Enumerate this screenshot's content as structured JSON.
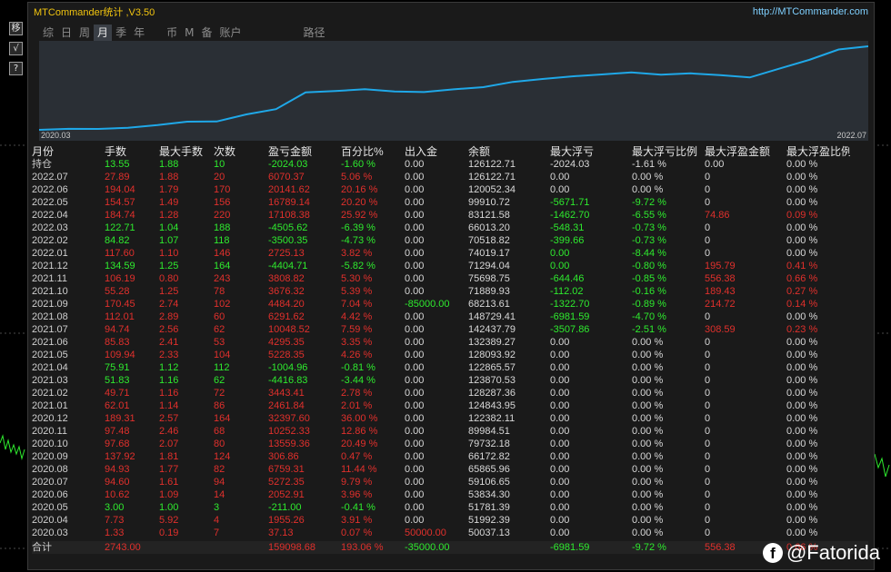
{
  "window": {
    "title": "MTCommander统计 ,V3.50",
    "url": "http://MTCommander.com"
  },
  "side_buttons": [
    "移",
    "√",
    "?"
  ],
  "tabs": [
    {
      "label": "综",
      "active": false
    },
    {
      "label": "日",
      "active": false
    },
    {
      "label": "周",
      "active": false
    },
    {
      "label": "月",
      "active": true
    },
    {
      "label": "季",
      "active": false
    },
    {
      "label": "年",
      "active": false
    },
    {
      "label": "币",
      "active": false
    },
    {
      "label": "M",
      "active": false
    },
    {
      "label": "备",
      "active": false
    },
    {
      "label": "账户",
      "active": false
    },
    {
      "label": "路径",
      "active": false
    }
  ],
  "chart_data": {
    "type": "line",
    "x_start": "2020.03",
    "x_end": "2022.07",
    "x": [
      "2020.03",
      "2020.04",
      "2020.05",
      "2020.06",
      "2020.07",
      "2020.08",
      "2020.09",
      "2020.10",
      "2020.11",
      "2020.12",
      "2021.01",
      "2021.02",
      "2021.03",
      "2021.04",
      "2021.05",
      "2021.06",
      "2021.07",
      "2021.08",
      "2021.09",
      "2021.10",
      "2021.11",
      "2021.12",
      "2022.01",
      "2022.02",
      "2022.03",
      "2022.04",
      "2022.05",
      "2022.06",
      "2022.07"
    ],
    "values": [
      37.13,
      1992.39,
      1781.39,
      3834.3,
      9106.65,
      15865.96,
      16172.82,
      29732.18,
      39984.51,
      72382.11,
      74843.95,
      78287.36,
      73870.53,
      72865.57,
      78093.92,
      82389.27,
      92437.79,
      98129.4,
      103213.61,
      106889.93,
      110698.75,
      106294.04,
      109019.17,
      105518.82,
      101013.2,
      118121.58,
      134910.72,
      155052.34,
      161122.71
    ],
    "line_color": "#1fa8e8"
  },
  "table": {
    "headers": [
      "月份",
      "手数",
      "最大手数",
      "次数",
      "盈亏金额",
      "百分比%",
      "出入金",
      "余额",
      "最大浮亏",
      "最大浮亏比例",
      "最大浮盈金额",
      "最大浮盈比例"
    ],
    "rows": [
      {
        "month": "持仓",
        "lots": "13.55",
        "max_lots": "1.88",
        "count": "10",
        "pnl": "-2024.03",
        "pct": "-1.60 %",
        "flow": "0.00",
        "balance": "126122.71",
        "max_loss": "-2024.03",
        "max_loss_pct": "-1.61 %",
        "max_gain": "0.00",
        "max_gain_pct": "0.00 %",
        "color": "g"
      },
      {
        "month": "2022.07",
        "lots": "27.89",
        "max_lots": "1.88",
        "count": "20",
        "pnl": "6070.37",
        "pct": "5.06 %",
        "flow": "0.00",
        "balance": "126122.71",
        "max_loss": "0.00",
        "max_loss_pct": "0.00 %",
        "max_gain": "0",
        "max_gain_pct": "0.00 %",
        "color": "r"
      },
      {
        "month": "2022.06",
        "lots": "194.04",
        "max_lots": "1.79",
        "count": "170",
        "pnl": "20141.62",
        "pct": "20.16 %",
        "flow": "0.00",
        "balance": "120052.34",
        "max_loss": "0.00",
        "max_loss_pct": "0.00 %",
        "max_gain": "0",
        "max_gain_pct": "0.00 %",
        "color": "r"
      },
      {
        "month": "2022.05",
        "lots": "154.57",
        "max_lots": "1.49",
        "count": "156",
        "pnl": "16789.14",
        "pct": "20.20 %",
        "flow": "0.00",
        "balance": "99910.72",
        "max_loss": "-5671.71",
        "max_loss_pct": "-9.72 %",
        "max_gain": "0",
        "max_gain_pct": "0.00 %",
        "color": "r",
        "loss_green": true
      },
      {
        "month": "2022.04",
        "lots": "184.74",
        "max_lots": "1.28",
        "count": "220",
        "pnl": "17108.38",
        "pct": "25.92 %",
        "flow": "0.00",
        "balance": "83121.58",
        "max_loss": "-1462.70",
        "max_loss_pct": "-6.55 %",
        "max_gain": "74.86",
        "max_gain_pct": "0.09 %",
        "color": "r",
        "loss_green": true,
        "gain_red": true
      },
      {
        "month": "2022.03",
        "lots": "122.71",
        "max_lots": "1.04",
        "count": "188",
        "pnl": "-4505.62",
        "pct": "-6.39 %",
        "flow": "0.00",
        "balance": "66013.20",
        "max_loss": "-548.31",
        "max_loss_pct": "-0.73 %",
        "max_gain": "0",
        "max_gain_pct": "0.00 %",
        "color": "g",
        "loss_green": true
      },
      {
        "month": "2022.02",
        "lots": "84.82",
        "max_lots": "1.07",
        "count": "118",
        "pnl": "-3500.35",
        "pct": "-4.73 %",
        "flow": "0.00",
        "balance": "70518.82",
        "max_loss": "-399.66",
        "max_loss_pct": "-0.73 %",
        "max_gain": "0",
        "max_gain_pct": "0.00 %",
        "color": "g",
        "loss_green": true
      },
      {
        "month": "2022.01",
        "lots": "117.60",
        "max_lots": "1.10",
        "count": "146",
        "pnl": "2725.13",
        "pct": "3.82 %",
        "flow": "0.00",
        "balance": "74019.17",
        "max_loss": "0.00",
        "max_loss_pct": "-8.44 %",
        "max_gain": "0",
        "max_gain_pct": "0.00 %",
        "color": "r",
        "loss_green": true
      },
      {
        "month": "2021.12",
        "lots": "134.59",
        "max_lots": "1.25",
        "count": "164",
        "pnl": "-4404.71",
        "pct": "-5.82 %",
        "flow": "0.00",
        "balance": "71294.04",
        "max_loss": "0.00",
        "max_loss_pct": "-0.80 %",
        "max_gain": "195.79",
        "max_gain_pct": "0.41 %",
        "color": "g",
        "loss_green": true,
        "gain_red": true
      },
      {
        "month": "2021.11",
        "lots": "106.19",
        "max_lots": "0.80",
        "count": "243",
        "pnl": "3808.82",
        "pct": "5.30 %",
        "flow": "0.00",
        "balance": "75698.75",
        "max_loss": "-644.46",
        "max_loss_pct": "-0.85 %",
        "max_gain": "556.38",
        "max_gain_pct": "0.66 %",
        "color": "r",
        "loss_green": true,
        "gain_red": true
      },
      {
        "month": "2021.10",
        "lots": "55.28",
        "max_lots": "1.25",
        "count": "78",
        "pnl": "3676.32",
        "pct": "5.39 %",
        "flow": "0.00",
        "balance": "71889.93",
        "max_loss": "-112.02",
        "max_loss_pct": "-0.16 %",
        "max_gain": "189.43",
        "max_gain_pct": "0.27 %",
        "color": "r",
        "loss_green": true,
        "gain_red": true
      },
      {
        "month": "2021.09",
        "lots": "170.45",
        "max_lots": "2.74",
        "count": "102",
        "pnl": "4484.20",
        "pct": "7.04 %",
        "flow": "-85000.00",
        "balance": "68213.61",
        "max_loss": "-1322.70",
        "max_loss_pct": "-0.89 %",
        "max_gain": "214.72",
        "max_gain_pct": "0.14 %",
        "color": "r",
        "flow_green": true,
        "loss_green": true,
        "gain_red": true
      },
      {
        "month": "2021.08",
        "lots": "112.01",
        "max_lots": "2.89",
        "count": "60",
        "pnl": "6291.62",
        "pct": "4.42 %",
        "flow": "0.00",
        "balance": "148729.41",
        "max_loss": "-6981.59",
        "max_loss_pct": "-4.70 %",
        "max_gain": "0",
        "max_gain_pct": "0.00 %",
        "color": "r",
        "loss_green": true
      },
      {
        "month": "2021.07",
        "lots": "94.74",
        "max_lots": "2.56",
        "count": "62",
        "pnl": "10048.52",
        "pct": "7.59 %",
        "flow": "0.00",
        "balance": "142437.79",
        "max_loss": "-3507.86",
        "max_loss_pct": "-2.51 %",
        "max_gain": "308.59",
        "max_gain_pct": "0.23 %",
        "color": "r",
        "loss_green": true,
        "gain_red": true
      },
      {
        "month": "2021.06",
        "lots": "85.83",
        "max_lots": "2.41",
        "count": "53",
        "pnl": "4295.35",
        "pct": "3.35 %",
        "flow": "0.00",
        "balance": "132389.27",
        "max_loss": "0.00",
        "max_loss_pct": "0.00 %",
        "max_gain": "0",
        "max_gain_pct": "0.00 %",
        "color": "r"
      },
      {
        "month": "2021.05",
        "lots": "109.94",
        "max_lots": "2.33",
        "count": "104",
        "pnl": "5228.35",
        "pct": "4.26 %",
        "flow": "0.00",
        "balance": "128093.92",
        "max_loss": "0.00",
        "max_loss_pct": "0.00 %",
        "max_gain": "0",
        "max_gain_pct": "0.00 %",
        "color": "r"
      },
      {
        "month": "2021.04",
        "lots": "75.91",
        "max_lots": "1.12",
        "count": "112",
        "pnl": "-1004.96",
        "pct": "-0.81 %",
        "flow": "0.00",
        "balance": "122865.57",
        "max_loss": "0.00",
        "max_loss_pct": "0.00 %",
        "max_gain": "0",
        "max_gain_pct": "0.00 %",
        "color": "g"
      },
      {
        "month": "2021.03",
        "lots": "51.83",
        "max_lots": "1.16",
        "count": "62",
        "pnl": "-4416.83",
        "pct": "-3.44 %",
        "flow": "0.00",
        "balance": "123870.53",
        "max_loss": "0.00",
        "max_loss_pct": "0.00 %",
        "max_gain": "0",
        "max_gain_pct": "0.00 %",
        "color": "g"
      },
      {
        "month": "2021.02",
        "lots": "49.71",
        "max_lots": "1.16",
        "count": "72",
        "pnl": "3443.41",
        "pct": "2.78 %",
        "flow": "0.00",
        "balance": "128287.36",
        "max_loss": "0.00",
        "max_loss_pct": "0.00 %",
        "max_gain": "0",
        "max_gain_pct": "0.00 %",
        "color": "r"
      },
      {
        "month": "2021.01",
        "lots": "62.01",
        "max_lots": "1.14",
        "count": "86",
        "pnl": "2461.84",
        "pct": "2.01 %",
        "flow": "0.00",
        "balance": "124843.95",
        "max_loss": "0.00",
        "max_loss_pct": "0.00 %",
        "max_gain": "0",
        "max_gain_pct": "0.00 %",
        "color": "r"
      },
      {
        "month": "2020.12",
        "lots": "189.31",
        "max_lots": "2.57",
        "count": "164",
        "pnl": "32397.60",
        "pct": "36.00 %",
        "flow": "0.00",
        "balance": "122382.11",
        "max_loss": "0.00",
        "max_loss_pct": "0.00 %",
        "max_gain": "0",
        "max_gain_pct": "0.00 %",
        "color": "r"
      },
      {
        "month": "2020.11",
        "lots": "97.48",
        "max_lots": "2.46",
        "count": "68",
        "pnl": "10252.33",
        "pct": "12.86 %",
        "flow": "0.00",
        "balance": "89984.51",
        "max_loss": "0.00",
        "max_loss_pct": "0.00 %",
        "max_gain": "0",
        "max_gain_pct": "0.00 %",
        "color": "r"
      },
      {
        "month": "2020.10",
        "lots": "97.68",
        "max_lots": "2.07",
        "count": "80",
        "pnl": "13559.36",
        "pct": "20.49 %",
        "flow": "0.00",
        "balance": "79732.18",
        "max_loss": "0.00",
        "max_loss_pct": "0.00 %",
        "max_gain": "0",
        "max_gain_pct": "0.00 %",
        "color": "r"
      },
      {
        "month": "2020.09",
        "lots": "137.92",
        "max_lots": "1.81",
        "count": "124",
        "pnl": "306.86",
        "pct": "0.47 %",
        "flow": "0.00",
        "balance": "66172.82",
        "max_loss": "0.00",
        "max_loss_pct": "0.00 %",
        "max_gain": "0",
        "max_gain_pct": "0.00 %",
        "color": "r"
      },
      {
        "month": "2020.08",
        "lots": "94.93",
        "max_lots": "1.77",
        "count": "82",
        "pnl": "6759.31",
        "pct": "11.44 %",
        "flow": "0.00",
        "balance": "65865.96",
        "max_loss": "0.00",
        "max_loss_pct": "0.00 %",
        "max_gain": "0",
        "max_gain_pct": "0.00 %",
        "color": "r"
      },
      {
        "month": "2020.07",
        "lots": "94.60",
        "max_lots": "1.61",
        "count": "94",
        "pnl": "5272.35",
        "pct": "9.79 %",
        "flow": "0.00",
        "balance": "59106.65",
        "max_loss": "0.00",
        "max_loss_pct": "0.00 %",
        "max_gain": "0",
        "max_gain_pct": "0.00 %",
        "color": "r"
      },
      {
        "month": "2020.06",
        "lots": "10.62",
        "max_lots": "1.09",
        "count": "14",
        "pnl": "2052.91",
        "pct": "3.96 %",
        "flow": "0.00",
        "balance": "53834.30",
        "max_loss": "0.00",
        "max_loss_pct": "0.00 %",
        "max_gain": "0",
        "max_gain_pct": "0.00 %",
        "color": "r"
      },
      {
        "month": "2020.05",
        "lots": "3.00",
        "max_lots": "1.00",
        "count": "3",
        "pnl": "-211.00",
        "pct": "-0.41 %",
        "flow": "0.00",
        "balance": "51781.39",
        "max_loss": "0.00",
        "max_loss_pct": "0.00 %",
        "max_gain": "0",
        "max_gain_pct": "0.00 %",
        "color": "g"
      },
      {
        "month": "2020.04",
        "lots": "7.73",
        "max_lots": "5.92",
        "count": "4",
        "pnl": "1955.26",
        "pct": "3.91 %",
        "flow": "0.00",
        "balance": "51992.39",
        "max_loss": "0.00",
        "max_loss_pct": "0.00 %",
        "max_gain": "0",
        "max_gain_pct": "0.00 %",
        "color": "r"
      },
      {
        "month": "2020.03",
        "lots": "1.33",
        "max_lots": "0.19",
        "count": "7",
        "pnl": "37.13",
        "pct": "0.07 %",
        "flow": "50000.00",
        "balance": "50037.13",
        "max_loss": "0.00",
        "max_loss_pct": "0.00 %",
        "max_gain": "0",
        "max_gain_pct": "0.00 %",
        "color": "r",
        "flow_red": true
      }
    ],
    "summary": {
      "month": "合计",
      "lots": "2743.00",
      "max_lots": "",
      "count": "",
      "pnl": "159098.68",
      "pct": "193.06 %",
      "flow": "-35000.00",
      "balance": "",
      "max_loss": "-6981.59",
      "max_loss_pct": "-9.72 %",
      "max_gain": "556.38",
      "max_gain_pct": "0.66 %"
    }
  },
  "watermark": "@Fatorida"
}
